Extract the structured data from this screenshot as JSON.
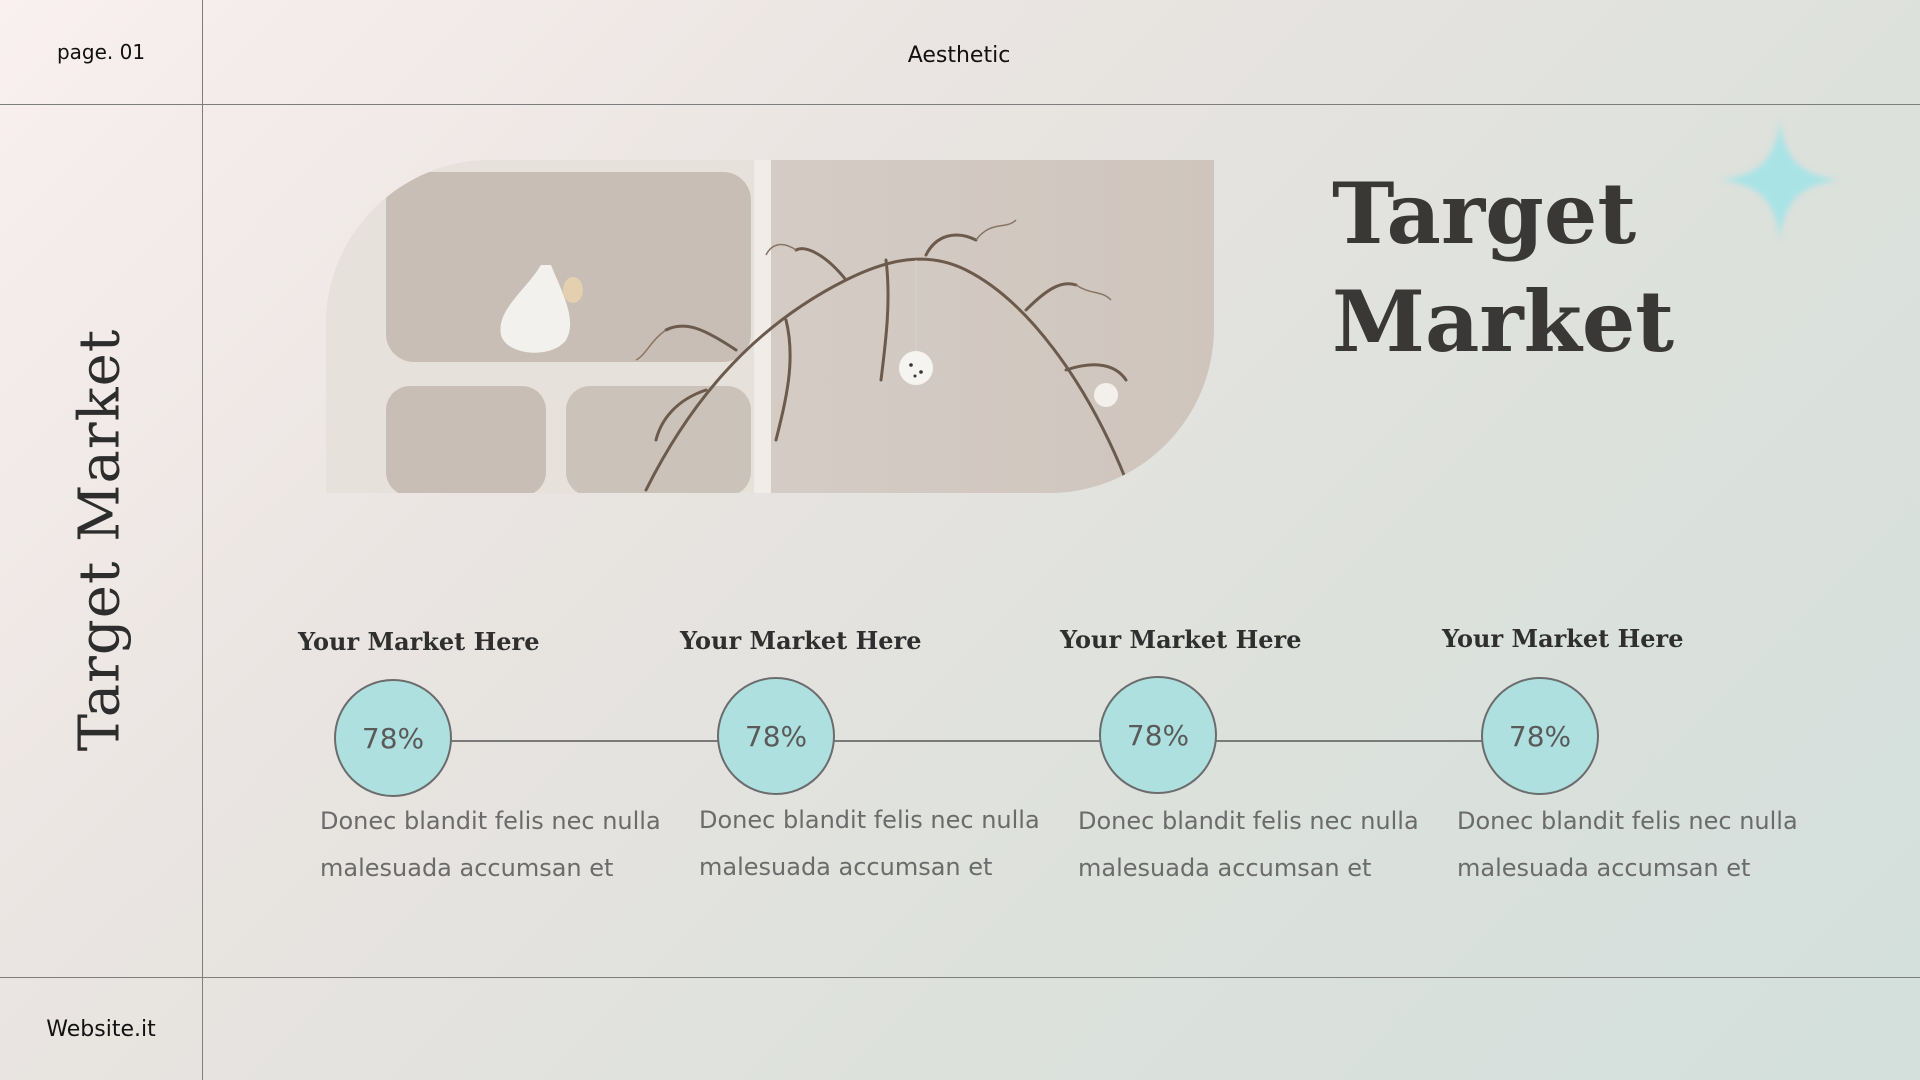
{
  "header": {
    "page": "page. 01",
    "title": "Aesthetic"
  },
  "footer": {
    "website": "Website.it"
  },
  "sidebar": {
    "title": "Target Market"
  },
  "main": {
    "title_line1": "Target",
    "title_line2": "Market"
  },
  "timeline": {
    "items": [
      {
        "heading": "Your Market Here",
        "percent": "78%",
        "text1": "Donec blandit felis nec nulla",
        "text2": "malesuada accumsan et"
      },
      {
        "heading": "Your Market Here",
        "percent": "78%",
        "text1": "Donec blandit felis nec nulla",
        "text2": "malesuada accumsan et"
      },
      {
        "heading": "Your Market Here",
        "percent": "78%",
        "text1": "Donec blandit felis nec nulla",
        "text2": "malesuada accumsan et"
      },
      {
        "heading": "Your Market Here",
        "percent": "78%",
        "text1": "Donec blandit felis nec nulla",
        "text2": "malesuada accumsan et"
      }
    ]
  },
  "colors": {
    "accent": "#afe0e0",
    "sparkle": "#a9e3e6",
    "text_dark": "#3a3836",
    "text_muted": "#6b6b6b"
  },
  "icons": {
    "sparkle": "sparkle-icon"
  }
}
